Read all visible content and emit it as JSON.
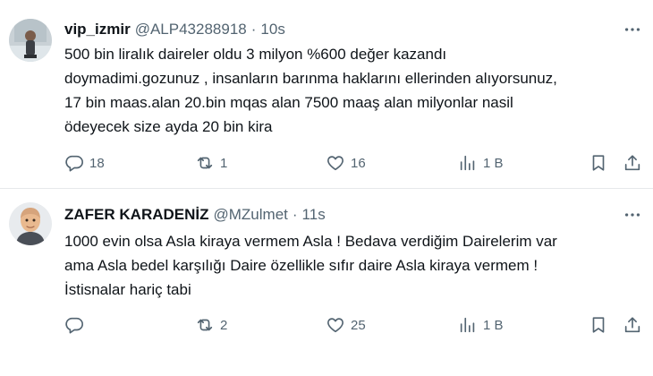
{
  "tweets": [
    {
      "name": "vip_izmir",
      "handle": "@ALP43288918",
      "dot": "·",
      "time": "10s",
      "lines": [
        "500 bin liralık daireler oldu 3 milyon %600 değer kazandı",
        "doymadimi.gozunuz , insanların barınma haklarını ellerinden alıyorsunuz,",
        "17 bin maas.alan 20.bin mqas alan 7500 maaş alan milyonlar nasil",
        "ödeyecek size ayda 20 bin kira"
      ],
      "replies": "18",
      "reposts": "1",
      "likes": "16",
      "views": "1 B"
    },
    {
      "name": "ZAFER KARADENİZ",
      "handle": "@MZulmet",
      "dot": "·",
      "time": "11s",
      "lines": [
        "1000 evin olsa Asla kiraya vermem Asla ! Bedava verdiğim Dairelerim var",
        "ama Asla bedel karşılığı Daire özellikle sıfır daire Asla kiraya vermem !",
        "İstisnalar hariç tabi"
      ],
      "replies": "",
      "reposts": "2",
      "likes": "25",
      "views": "1 B"
    }
  ],
  "icons": {
    "reply": "reply-icon",
    "repost": "repost-icon",
    "like": "like-icon",
    "views": "views-icon",
    "bookmark": "bookmark-icon",
    "share": "share-icon",
    "more": "more-icon"
  },
  "colors": {
    "text": "#0f1419",
    "secondary": "#536471",
    "divider": "#e6e9eb"
  }
}
